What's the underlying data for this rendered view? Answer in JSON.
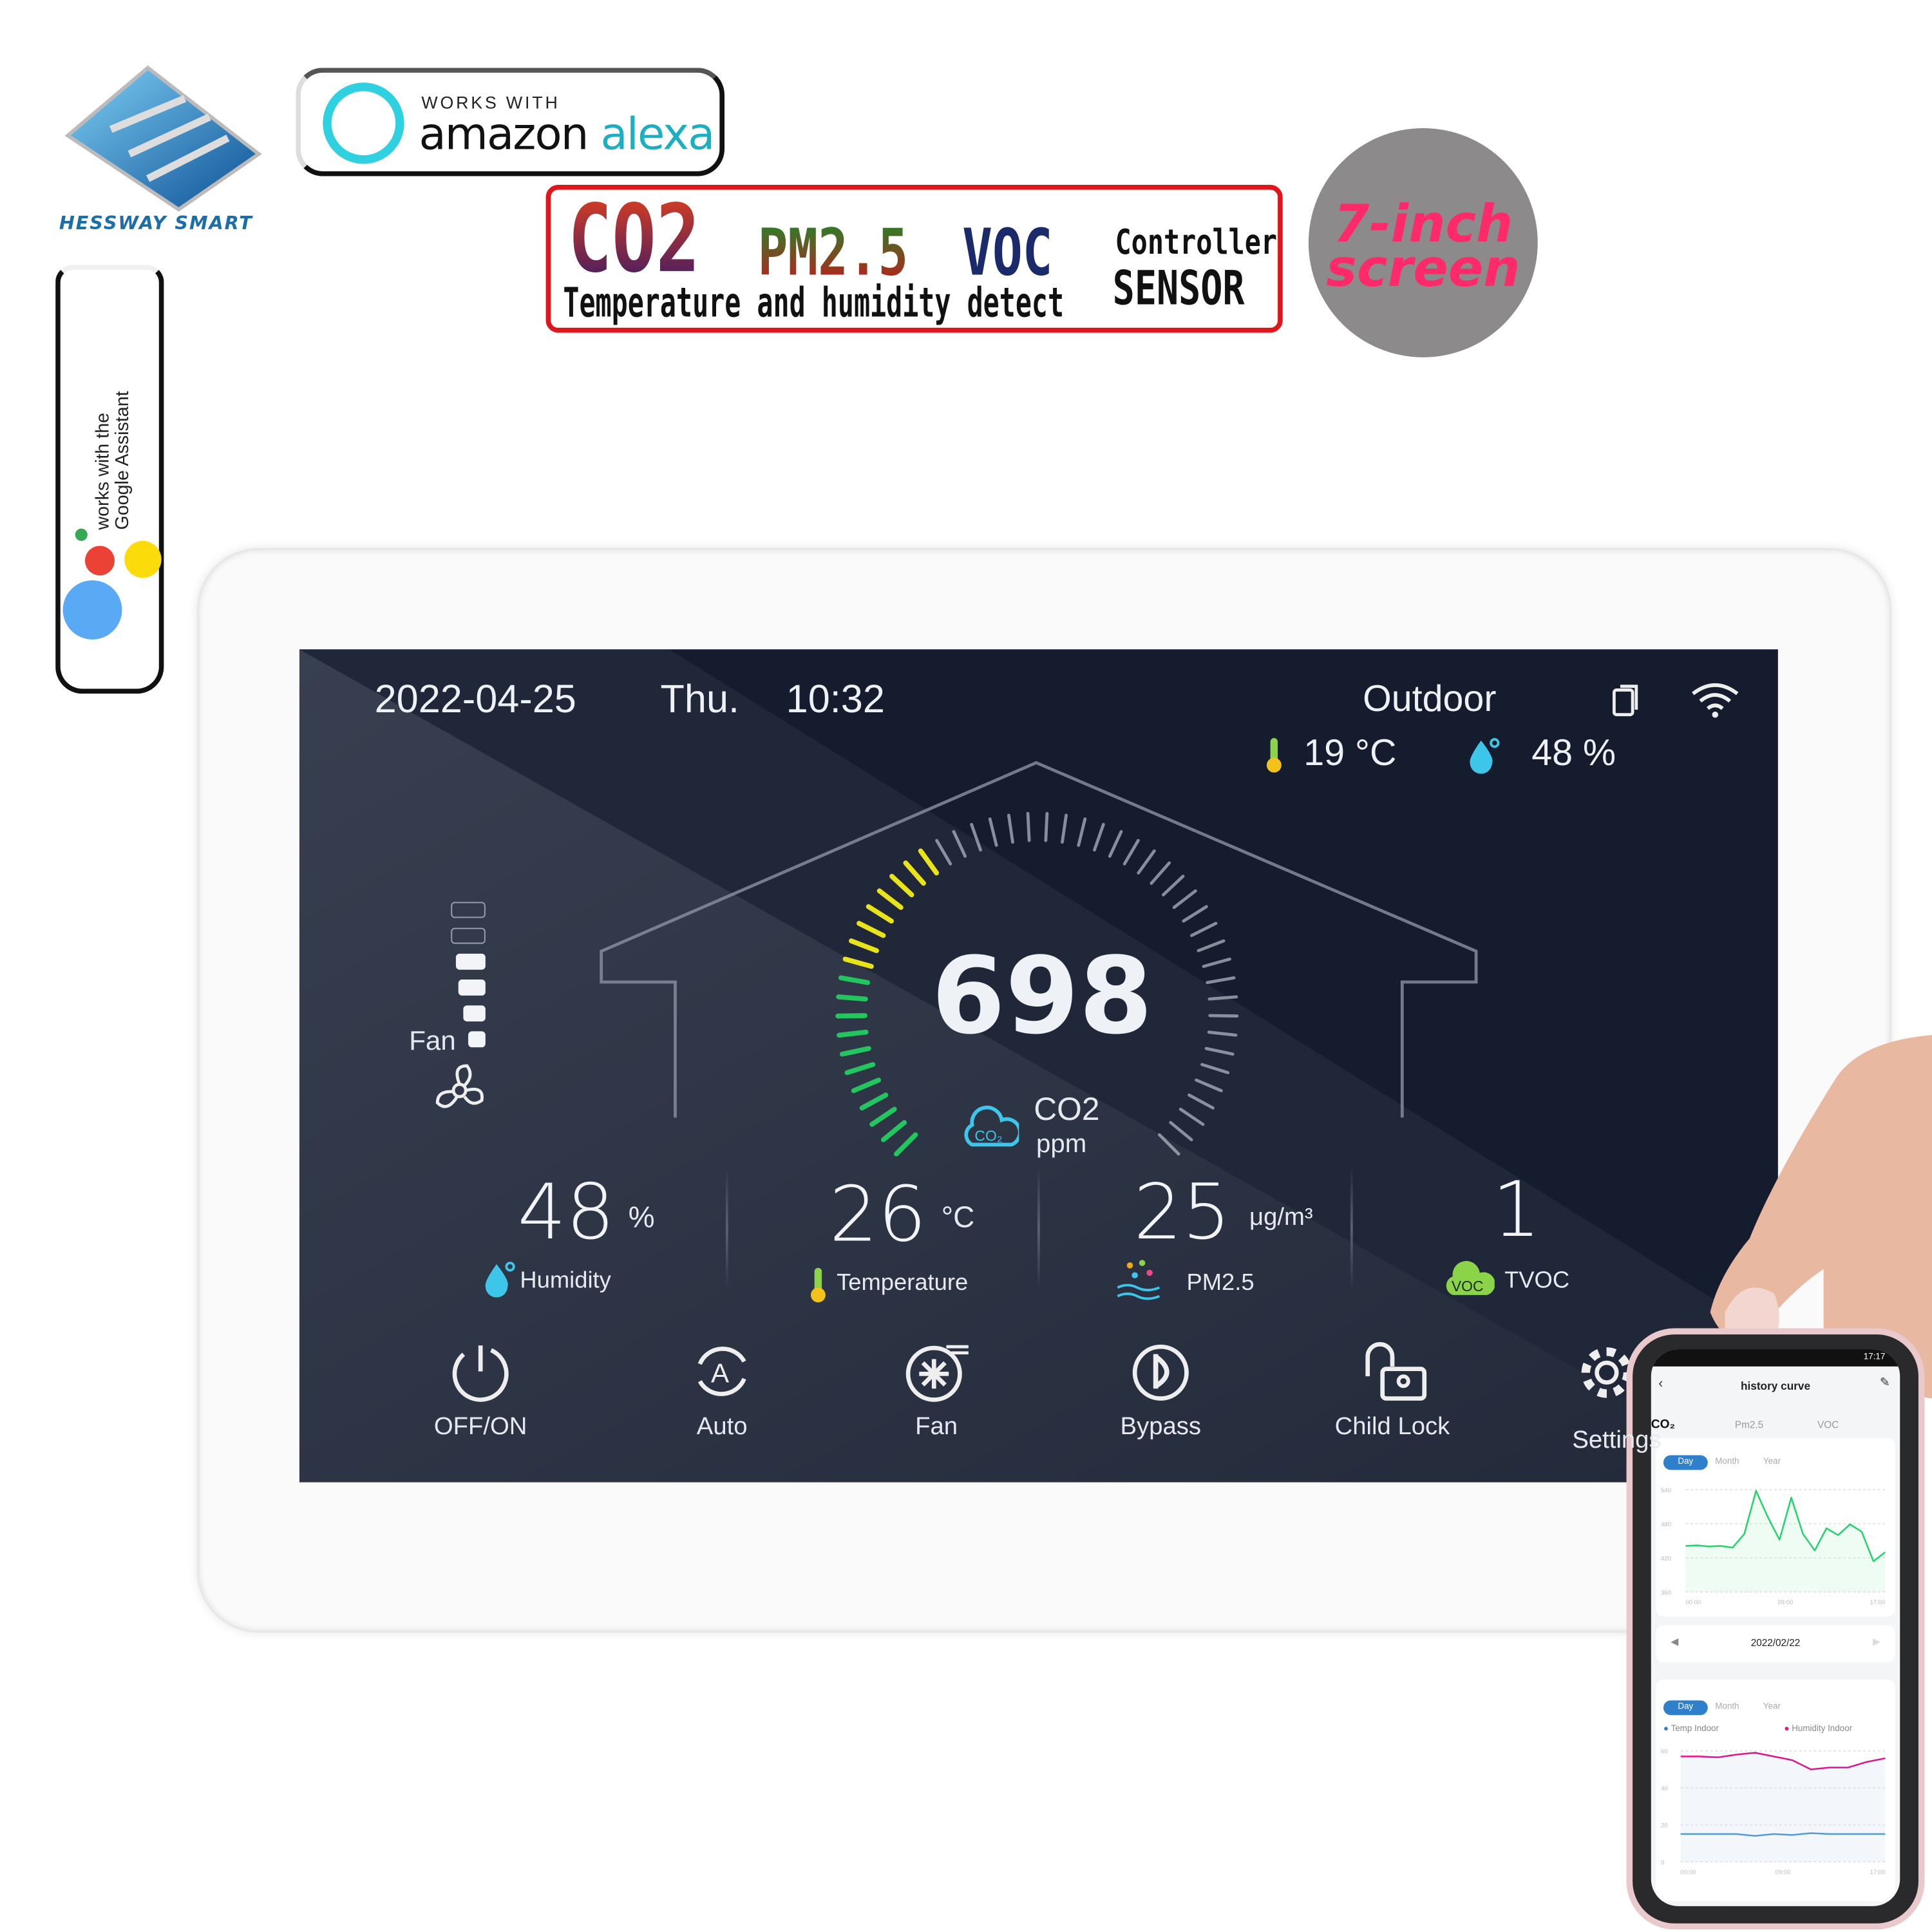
{
  "brand": {
    "name": "HESSWAY SMART"
  },
  "alexa_badge": {
    "works_with": "WORKS WITH",
    "amazon": "amazon",
    "alexa": "alexa"
  },
  "headline": {
    "co2": "CO2",
    "pm25": "PM2.5",
    "voc": "VOC",
    "controller": "Controller",
    "sensor": "SENSOR",
    "subtitle": "Temperature and humidity detect"
  },
  "screen_badge": {
    "line1": "7-inch",
    "line2": "screen"
  },
  "google_badge": {
    "line1": "works with the",
    "line2": "Google Assistant"
  },
  "device": {
    "header": {
      "date": "2022-04-25",
      "weekday": "Thu.",
      "time": "10:32",
      "outdoor_label": "Outdoor",
      "outdoor_temp": "19 °C",
      "outdoor_humidity": "48 %",
      "icons": [
        "copy-icon",
        "wifi-icon"
      ]
    },
    "co2": {
      "value": "698",
      "label": "CO2",
      "unit": "ppm",
      "gauge_fill": 0.38,
      "gauge_colors": [
        "#22c55e",
        "#e8e31a"
      ]
    },
    "fan": {
      "label": "Fan",
      "level": 4,
      "levels": 6
    },
    "metrics": [
      {
        "value": "48",
        "unit": "%",
        "label": "Humidity",
        "icon": "humidity-icon"
      },
      {
        "value": "26",
        "unit": "°C",
        "label": "Temperature",
        "icon": "thermometer-icon"
      },
      {
        "value": "25",
        "unit": "μg/m³",
        "label": "PM2.5",
        "icon": "pm25-icon"
      },
      {
        "value": "1",
        "unit": "",
        "label": "TVOC",
        "icon": "voc-icon"
      }
    ],
    "buttons": [
      {
        "label": "OFF/ON",
        "icon": "power-icon"
      },
      {
        "label": "Auto",
        "icon": "auto-icon"
      },
      {
        "label": "Fan",
        "icon": "fan-mode-icon"
      },
      {
        "label": "Bypass",
        "icon": "bypass-icon"
      },
      {
        "label": "Child Lock",
        "icon": "child-lock-icon"
      },
      {
        "label": "Settings",
        "icon": "gear-icon"
      }
    ],
    "buttons_visible_label_last": "Setti",
    "accent": "#3ec6ea"
  },
  "phone": {
    "status_time": "17:17",
    "title": "history curve",
    "tabs": [
      "CO₂",
      "Pm2.5",
      "VOC"
    ],
    "range_tabs": [
      "Day",
      "Month",
      "Year"
    ],
    "date": "2022/02/22",
    "legend": [
      "Temp Indoor",
      "Humidity Indoor"
    ]
  },
  "chart_data": [
    {
      "type": "line",
      "title": "",
      "x_ticks": [
        "00:00",
        "09:00",
        "17:00"
      ],
      "y_ticks": [
        "540",
        "480",
        "420",
        "360"
      ],
      "ylim": [
        360,
        540
      ],
      "grid": true,
      "series": [
        {
          "color": "#22d36a",
          "values": [
            441,
            442,
            440,
            441,
            438,
            462,
            538,
            492,
            452,
            526,
            462,
            433,
            472,
            460,
            479,
            466,
            414,
            430
          ]
        }
      ]
    },
    {
      "type": "line",
      "title": "",
      "x_ticks": [
        "00:00",
        "09:00",
        "17:00"
      ],
      "y_ticks": [
        "60",
        "40",
        "20",
        "0"
      ],
      "ylim": [
        0,
        60
      ],
      "grid": true,
      "legend": "top",
      "series": [
        {
          "name": "Temp Indoor",
          "color": "#2f80cc",
          "values": [
            15,
            15,
            15,
            15,
            14,
            15,
            14.5,
            15.5,
            15,
            15,
            15,
            15
          ]
        },
        {
          "name": "Humidity Indoor",
          "color": "#e0148c",
          "values": [
            57,
            57,
            56.5,
            58,
            59,
            57,
            55,
            50,
            51,
            51,
            54,
            56
          ]
        }
      ]
    }
  ]
}
